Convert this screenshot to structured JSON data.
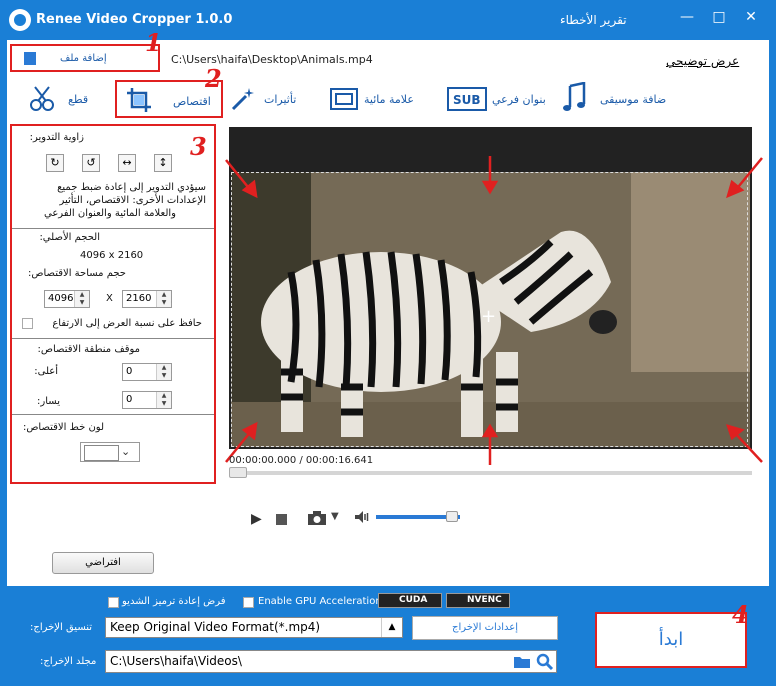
{
  "window": {
    "title": "Renee Video Cropper 1.0.0",
    "report_bug": "تقرير الأخطاء",
    "help": "عرض توضيحي"
  },
  "file": {
    "add_label": "إضافة ملف",
    "path": "C:\\Users\\haifa\\Desktop\\Animals.mp4"
  },
  "tabs": [
    {
      "label": "قطع",
      "icon": "scissors-icon"
    },
    {
      "label": "اقتصاص",
      "icon": "crop-icon",
      "active": true
    },
    {
      "label": "تأثيرات",
      "icon": "magic-wand-icon"
    },
    {
      "label": "علامة مائية",
      "icon": "watermark-icon"
    },
    {
      "label": "بنوان فرعي",
      "icon": "subtitle-icon"
    },
    {
      "label": "ضافة موسيقى",
      "icon": "music-icon"
    }
  ],
  "badges": [
    "1",
    "2",
    "3",
    "4"
  ],
  "rotation": {
    "title": "زاوية التدوير:",
    "note_lines": [
      "سيؤدي التدوير إلى إعادة ضبط جميع",
      "الإعدادات الأخرى: الاقتصاص، التأثير",
      "والعلامة المائية والعنوان الفرعي"
    ]
  },
  "size": {
    "original_label": "الحجم الأصلي:",
    "original_value": "4096 x 2160",
    "crop_label": "حجم مساحة الاقتصاص:",
    "width": "4096",
    "x_sep": "X",
    "height": "2160",
    "keep_ratio": "حافظ على نسبة العرض إلى الارتفاع"
  },
  "position": {
    "title": "موقف منطقة الاقتصاص:",
    "top_label": "أعلى:",
    "top_value": "0",
    "left_label": "يسار:",
    "left_value": "0"
  },
  "line_color": {
    "label": "لون خط الاقتصاص:"
  },
  "default_button": "افتراضي",
  "player": {
    "timecode": "00:00:00.000 / 00:00:16.641",
    "progress": 0,
    "volume": 0.9
  },
  "bottom": {
    "reencode": "فرض إعادة ترميز الشديو",
    "gpu": "Enable GPU Acceleration",
    "cuda": "CUDA",
    "nvenc": "NVENC",
    "format_label": "تنسيق الإخراج:",
    "format_value": "Keep Original Video Format(*.mp4)",
    "settings_button": "إعدادات الإخراج",
    "folder_label": "مجلد الإخراج:",
    "folder_value": "C:\\Users\\haifa\\Videos\\",
    "start_button": "ابدأ"
  },
  "colors": {
    "accent": "#1a7fd6",
    "highlight": "#e02020"
  }
}
